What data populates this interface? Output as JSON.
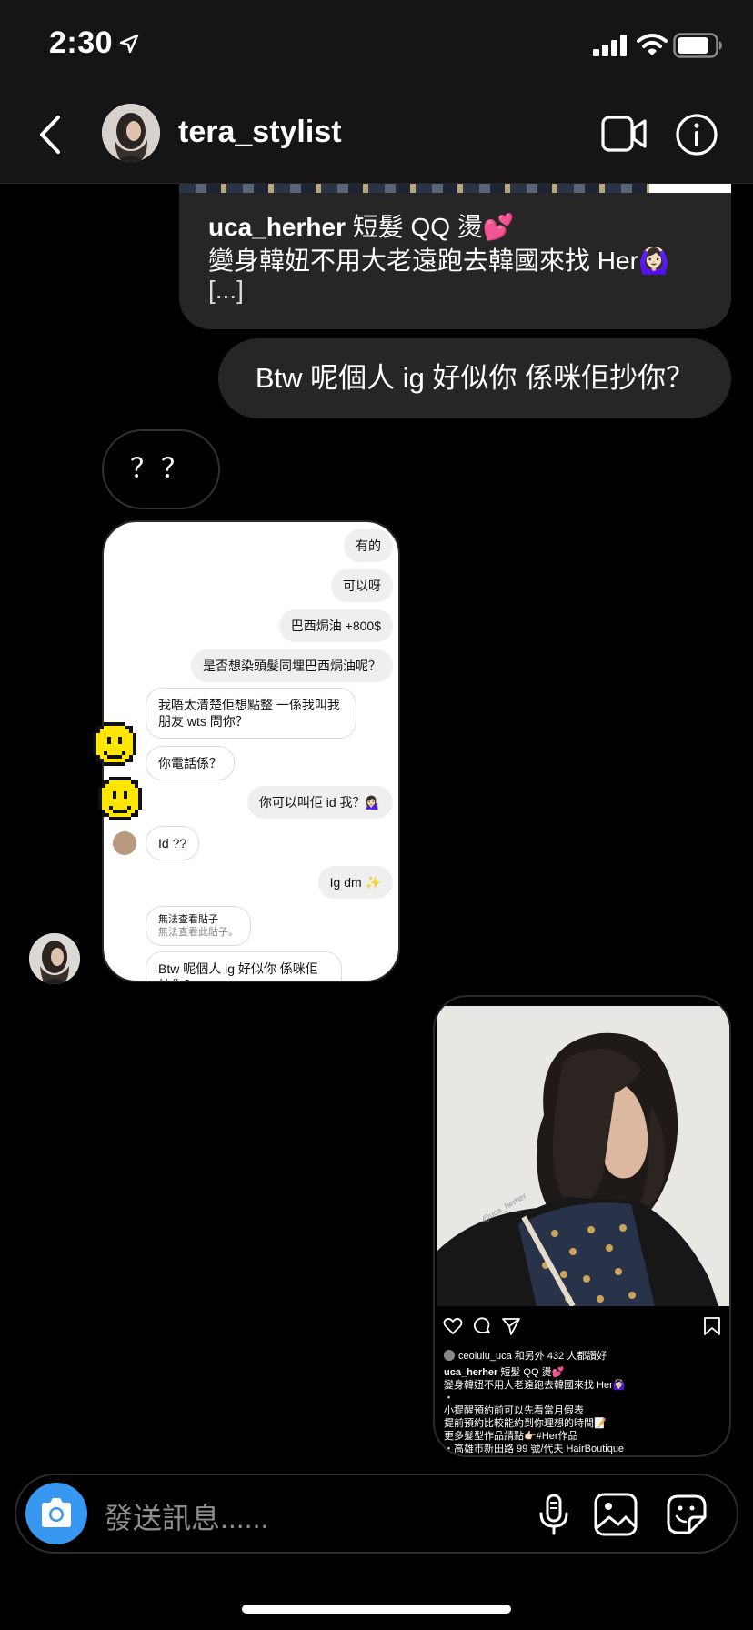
{
  "status_bar": {
    "time": "2:30"
  },
  "header": {
    "username": "tera_stylist"
  },
  "messages": {
    "shared_caption": {
      "username": "uca_herher",
      "line1": " 短髮 QQ 燙💕",
      "line2": "變身韓妞不用大老遠跑去韓國來找 Her🙆🏻‍♀️",
      "more": "[...]"
    },
    "outgoing_text": "Btw 呢個人 ig 好似你 係咪佢抄你？",
    "incoming_text": "？？",
    "screenshot": {
      "m1": "有的",
      "m2": "可以呀",
      "m3": "巴西焗油 +800$",
      "m4": "是否想染頭髮同埋巴西焗油呢？",
      "m5": "我唔太清楚佢想點整 一係我叫我朋友 wts 問你？",
      "m6": "你電話係？",
      "m7": "你可以叫佢 id 我？💁🏻‍♀️",
      "m8": "Id ??",
      "m9": "Ig dm ✨",
      "m10_title": "無法查看貼子",
      "m10_sub": "無法查看此貼子。",
      "m11": "Btw 呢個人 ig 好似你 係咪佢抄你？"
    },
    "post": {
      "watermark": "@uca_herher",
      "likes": "ceolulu_uca 和另外 432 人都讚好",
      "caption_user": "uca_herher",
      "caption_line1": " 短髮 QQ 燙💕",
      "caption_line2": "變身韓妞不用大老遠跑去韓國來找 Her🙆🏻‍♀️",
      "caption_line3": "・",
      "caption_line4": "小提醒預約前可以先看當月假表",
      "caption_line5": "提前預約比較能約到你理想的時間📝",
      "caption_line6": "更多髮型作品請點👉🏻#Her作品",
      "caption_line7": "・高雄市新田路 99 號/代夫 HairBoutique"
    }
  },
  "composer": {
    "placeholder": "發送訊息......"
  },
  "colors": {
    "accent": "#3897f0",
    "bubble": "#262626",
    "background": "#000000",
    "bar": "#151515"
  }
}
